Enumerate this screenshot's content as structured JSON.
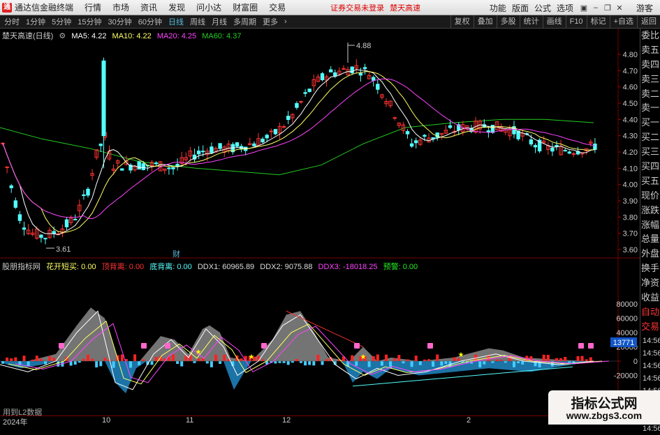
{
  "app": {
    "title": "通达信金融终端",
    "menu": [
      "行情",
      "市场",
      "资讯",
      "发现",
      "问小达",
      "财富圈",
      "交易"
    ],
    "notice": "证券交易未登录",
    "stock_name": "楚天高速",
    "right_menu": [
      "功能",
      "版面",
      "公式",
      "选项"
    ],
    "guest": "游客"
  },
  "toolbar": {
    "periods": [
      "分时",
      "1分钟",
      "5分钟",
      "15分钟",
      "30分钟",
      "60分钟",
      "日线",
      "周线",
      "月线",
      "多周期",
      "更多"
    ],
    "active_period": "日线",
    "tools": [
      "复权",
      "叠加",
      "多股",
      "统计",
      "画线",
      "F10",
      "标记",
      "+自选",
      "返回"
    ]
  },
  "main_chart": {
    "title": "楚天高速(日线)",
    "ma5": "MA5: 4.22",
    "ma10": "MA10: 4.22",
    "ma20": "MA20: 4.25",
    "ma60": "MA60: 4.37",
    "high_label": "4.88",
    "low_label": "3.61",
    "cai_label": "财",
    "y_ticks": [
      "4.80",
      "4.70",
      "4.60",
      "4.50",
      "4.40",
      "4.30",
      "4.20",
      "4.10",
      "4.00",
      "3.90",
      "3.80",
      "3.70",
      "3.60"
    ],
    "colors": {
      "up": "#ff3333",
      "down": "#54ffff",
      "ma5": "#ffffff",
      "ma10": "#ffff66",
      "ma20": "#ff44ff",
      "ma60": "#22cc22"
    }
  },
  "indicator": {
    "name": "股朋指标网",
    "fields": [
      {
        "label": "花开短买: 0.00",
        "color": "#ffff66"
      },
      {
        "label": "顶背离: 0.00",
        "color": "#ff3333"
      },
      {
        "label": "底背离: 0.00",
        "color": "#54ffff"
      },
      {
        "label": "DDX1: 60965.89",
        "color": "#dddddd"
      },
      {
        "label": "DDX2: 9075.88",
        "color": "#dddddd"
      },
      {
        "label": "DDX3: -18018.25",
        "color": "#ff44ff"
      },
      {
        "label": "预警: 0.00",
        "color": "#22ee22"
      }
    ],
    "y_ticks": [
      "80000",
      "60000",
      "40000",
      "20000",
      "0",
      "-20000"
    ],
    "current_value": "13771",
    "hint": "用到L2数据"
  },
  "side_panel": {
    "items": [
      "委比",
      "卖五",
      "卖四",
      "卖三",
      "卖二",
      "卖一",
      "买一",
      "买二",
      "买三",
      "买四",
      "买五",
      "现价",
      "涨跌",
      "涨幅",
      "总量",
      "外盘",
      "换手",
      "净资",
      "收益"
    ],
    "auto_label": "自动",
    "trade_label": "交易",
    "times": [
      "14:56",
      "14:56",
      "14:56",
      "14:56",
      "14:56",
      "14:56",
      "14:56",
      "14:56"
    ]
  },
  "x_axis": {
    "labels": [
      "2024年",
      "10",
      "11",
      "12",
      "2"
    ]
  },
  "watermark": {
    "line1": "指标公式网",
    "line2": "www.zbgs3.com"
  }
}
